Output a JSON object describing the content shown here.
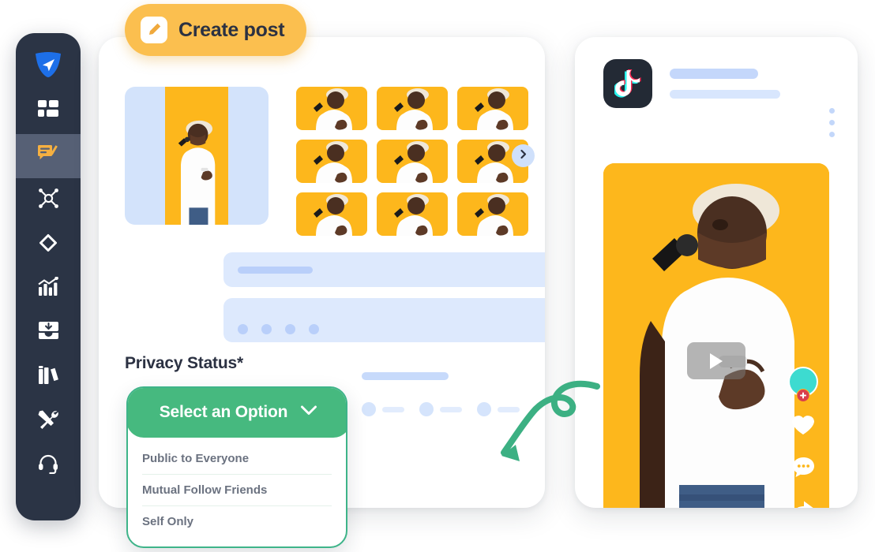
{
  "app": {
    "accent_green": "#46b97f",
    "accent_orange": "#fbbf4f",
    "sidebar_bg": "#2b3445",
    "skeleton_blue": "#dde9fd",
    "photo_yellow": "#fdb71c"
  },
  "sidebar": {
    "logo": {
      "name": "send-logo-icon",
      "label": "Send"
    },
    "items": [
      {
        "icon": "dashboard-grid-icon",
        "label": "Dashboard",
        "active": false
      },
      {
        "icon": "create-post-chat-icon",
        "label": "Create Post",
        "active": true
      },
      {
        "icon": "network-nodes-icon",
        "label": "Channels",
        "active": false
      },
      {
        "icon": "automation-diamond-icon",
        "label": "Automation",
        "active": false
      },
      {
        "icon": "analytics-chart-icon",
        "label": "Analytics",
        "active": false
      },
      {
        "icon": "inbox-download-icon",
        "label": "Inbox",
        "active": false
      },
      {
        "icon": "library-books-icon",
        "label": "Library",
        "active": false
      },
      {
        "icon": "tools-icon",
        "label": "Tools",
        "active": false
      },
      {
        "icon": "headset-support-icon",
        "label": "Support",
        "active": false
      }
    ]
  },
  "composer": {
    "badge": {
      "label": "Create post",
      "icon": "pencil-edit-icon"
    },
    "media": {
      "selected_alt": "Man in white hat singing into a microphone on a yellow background",
      "thumbnail_count": 9,
      "next_icon": "chevron-right-icon"
    },
    "fields": [
      {
        "name": "title-field",
        "placeholder": ""
      },
      {
        "name": "description-field",
        "placeholder": ""
      }
    ],
    "privacy": {
      "label": "Privacy Status*",
      "selected": "Select an Option",
      "chevron": "chevron-down-icon",
      "options": [
        "Public to Everyone",
        "Mutual Follow Friends",
        "Self Only"
      ]
    }
  },
  "preview": {
    "platform": "TikTok",
    "platform_icon": "tiktok-note-icon",
    "menu_icon": "more-vertical-icon",
    "play_icon": "play-icon",
    "username_symbol": "@",
    "actions": [
      {
        "icon": "avatar-follow-icon",
        "label": "Follow"
      },
      {
        "icon": "heart-like-icon",
        "label": "Like"
      },
      {
        "icon": "comment-bubble-icon",
        "label": "Comment"
      },
      {
        "icon": "share-arrow-icon",
        "label": "Share"
      }
    ]
  },
  "annotation": {
    "arrow": "curved-green-arrow"
  }
}
